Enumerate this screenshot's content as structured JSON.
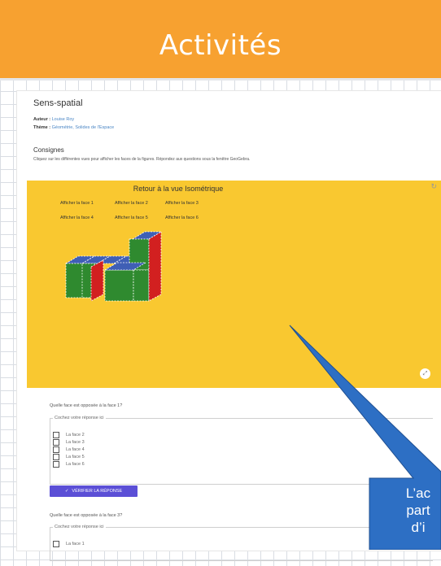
{
  "banner": {
    "title": "Activités"
  },
  "activity": {
    "title": "Sens-spatial",
    "author_label": "Auteur :",
    "author": "Louise Roy",
    "theme_label": "Thème :",
    "theme": "Géométrie, Solides de l'Espace",
    "consignes_title": "Consignes",
    "consignes_text": "Cliquez sur les différentes vues pour afficher les faces de la figures. Répondez aux questions sous la fenêtre GeoGebra."
  },
  "geogebra": {
    "reset_label": "Retour à la vue Isométrique",
    "buttons": [
      "Afficher la face 1",
      "Afficher la face 2",
      "Afficher la face 3",
      "Afficher la face 4",
      "Afficher la face 5",
      "Afficher la face 6"
    ]
  },
  "question1": {
    "text": "Quelle face est opposée à la face 1?",
    "legend": "Cochez votre réponse ici",
    "options": [
      "La face 2",
      "La face 3",
      "La face 4",
      "La face 5",
      "La face 6"
    ],
    "verify_label": "VÉRIFIER LA RÉPONSE"
  },
  "question2": {
    "text": "Quelle face est opposée à la face 3?",
    "legend": "Cochez votre réponse ici",
    "options": [
      "La face 1"
    ]
  },
  "callout": {
    "line1": "L’ac",
    "line2": "part",
    "line3": "d’i"
  },
  "colors": {
    "banner": "#f7a130",
    "geogebra_bg": "#f9c830",
    "verify_button": "#5b4fd6",
    "callout": "#2d6fc4"
  }
}
